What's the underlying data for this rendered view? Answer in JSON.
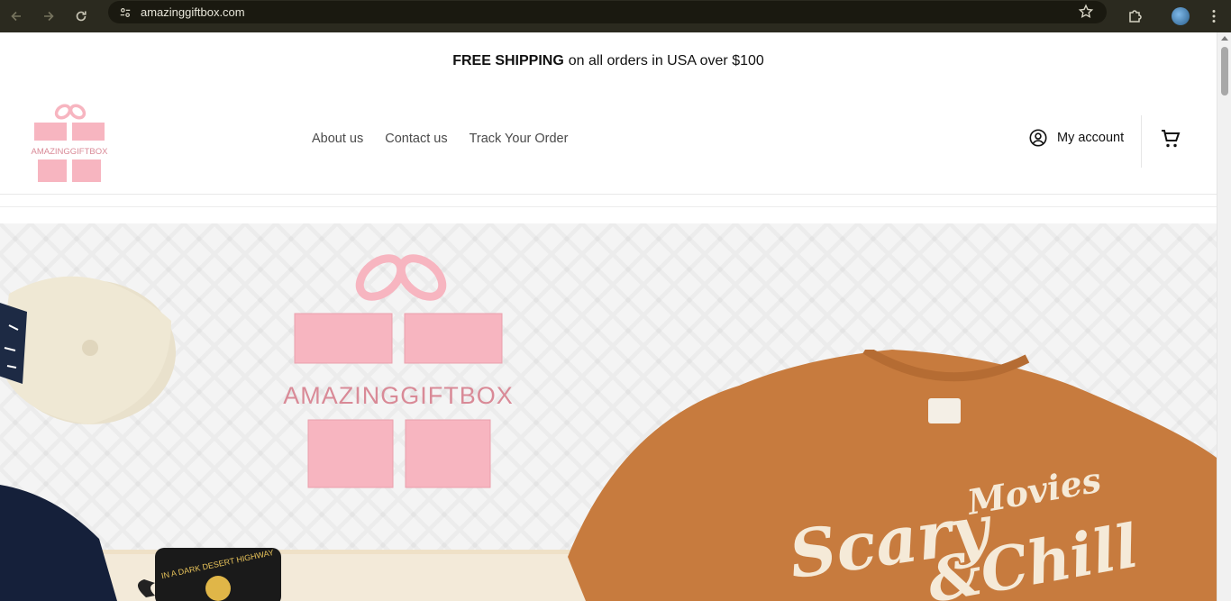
{
  "browser": {
    "url": "amazinggiftbox.com",
    "icons": [
      "back-icon",
      "forward-icon",
      "reload-icon",
      "site-settings-icon",
      "bookmark-star-icon",
      "extensions-icon",
      "profile-avatar",
      "menu-dots-icon"
    ]
  },
  "announcement": {
    "bold": "FREE SHIPPING",
    "rest": "on all orders in USA over $100"
  },
  "header": {
    "logo_text": "AMAZINGGIFTBOX",
    "nav": [
      {
        "label": "About us"
      },
      {
        "label": "Contact us"
      },
      {
        "label": "Track Your Order"
      }
    ],
    "account_label": "My account",
    "cart_icon": "cart-icon"
  },
  "hero": {
    "logo_text": "AMAZINGGIFTBOX",
    "shirt_text_big": "Scary",
    "shirt_text_small": "Movies",
    "shirt_text_bottom": "&Chill",
    "mug_text": "IN A DARK DESERT HIGHWAY"
  },
  "colors": {
    "brand_pink": "#f7b5c0",
    "brand_text": "#d98a97",
    "chrome_bg": "#2b2a1f",
    "shirt_orange": "#c77b3e"
  }
}
